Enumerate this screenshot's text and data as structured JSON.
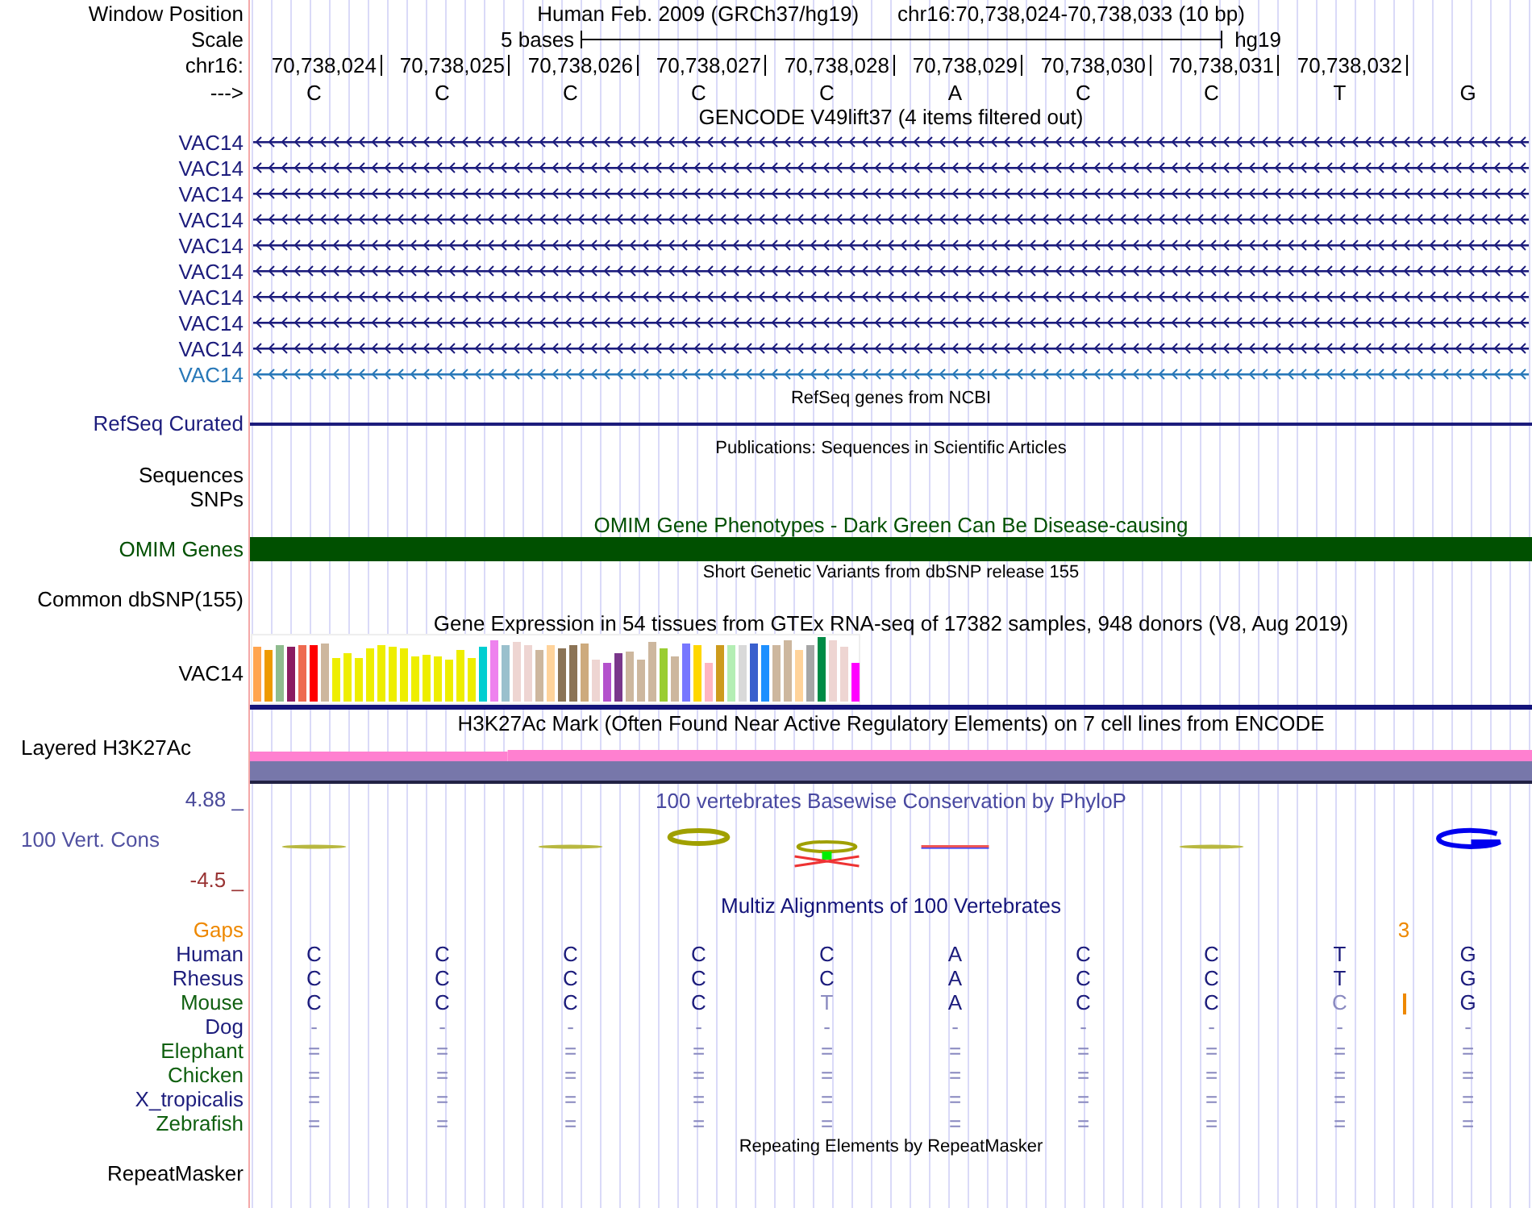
{
  "header": {
    "position_label": "Window Position",
    "assembly": "Human Feb. 2009 (GRCh37/hg19)",
    "range": "chr16:70,738,024-70,738,033 (10 bp)",
    "scale_label": "Scale",
    "scale_length": "5 bases",
    "scale_assembly": "hg19",
    "chrom_label": "chr16:",
    "ticks": [
      "70,738,024",
      "70,738,025",
      "70,738,026",
      "70,738,027",
      "70,738,028",
      "70,738,029",
      "70,738,030",
      "70,738,031",
      "70,738,032"
    ],
    "strand_label": "--->",
    "bases": [
      "C",
      "C",
      "C",
      "C",
      "C",
      "A",
      "C",
      "C",
      "T",
      "G"
    ]
  },
  "tracks": [
    {
      "kind": "genes",
      "title": "GENCODE V49lift37 (4 items filtered out)",
      "items": [
        {
          "name": "VAC14",
          "color": "#1c1c7c"
        },
        {
          "name": "VAC14",
          "color": "#1c1c7c"
        },
        {
          "name": "VAC14",
          "color": "#1c1c7c"
        },
        {
          "name": "VAC14",
          "color": "#1c1c7c"
        },
        {
          "name": "VAC14",
          "color": "#1c1c7c"
        },
        {
          "name": "VAC14",
          "color": "#1c1c7c"
        },
        {
          "name": "VAC14",
          "color": "#1c1c7c"
        },
        {
          "name": "VAC14",
          "color": "#1c1c7c"
        },
        {
          "name": "VAC14",
          "color": "#1c1c7c"
        },
        {
          "name": "VAC14",
          "color": "#2878b8"
        }
      ]
    },
    {
      "kind": "line",
      "title": "RefSeq genes from NCBI",
      "label": "RefSeq Curated",
      "color": "#1c1c7c"
    },
    {
      "kind": "empty",
      "title": "Publications: Sequences in Scientific Articles",
      "labels": [
        "Sequences",
        "SNPs"
      ]
    },
    {
      "kind": "bar",
      "title": "OMIM Gene Phenotypes - Dark Green Can Be Disease-causing",
      "label": "OMIM Genes",
      "color": "#005000"
    },
    {
      "kind": "empty",
      "title": "Short Genetic Variants from dbSNP release 155",
      "labels": [
        "Common dbSNP(155)"
      ]
    },
    {
      "kind": "gtex",
      "title": "Gene Expression in 54 tissues from GTEx RNA-seq of 17382 samples, 948 donors (V8, Aug 2019)",
      "label": "VAC14"
    },
    {
      "kind": "signal",
      "title": "H3K27Ac Mark (Often Found Near Active Regulatory Elements) on 7 cell lines from ENCODE",
      "label": "Layered H3K27Ac"
    },
    {
      "kind": "phylop",
      "title": "100 vertebrates Basewise Conservation by PhyloP",
      "label": "100 Vert. Cons",
      "max": "4.88 _",
      "min": "-4.5 _"
    },
    {
      "kind": "multiz",
      "title": "Multiz Alignments of 100 Vertebrates",
      "gaps": {
        "label": "Gaps",
        "count": "3"
      },
      "species": [
        {
          "name": "Human",
          "color": "#1c1c7c",
          "insertion": false,
          "bases": [
            "C",
            "C",
            "C",
            "C",
            "C",
            "A",
            "C",
            "C",
            "T",
            "G"
          ]
        },
        {
          "name": "Rhesus",
          "color": "#1c1c7c",
          "insertion": false,
          "bases": [
            "C",
            "C",
            "C",
            "C",
            "C",
            "A",
            "C",
            "C",
            "T",
            "G"
          ]
        },
        {
          "name": "Mouse",
          "color": "#106010",
          "insertion": true,
          "bases": [
            "C",
            "C",
            "C",
            "C",
            "T",
            "A",
            "C",
            "C",
            "C",
            "G"
          ]
        },
        {
          "name": "Dog",
          "color": "#1c1c7c",
          "insertion": false,
          "bases": [
            "-",
            "-",
            "-",
            "-",
            "-",
            "-",
            "-",
            "-",
            "-",
            "-"
          ]
        },
        {
          "name": "Elephant",
          "color": "#106010",
          "insertion": false,
          "bases": [
            "=",
            "=",
            "=",
            "=",
            "=",
            "=",
            "=",
            "=",
            "=",
            "="
          ]
        },
        {
          "name": "Chicken",
          "color": "#106010",
          "insertion": false,
          "bases": [
            "=",
            "=",
            "=",
            "=",
            "=",
            "=",
            "=",
            "=",
            "=",
            "="
          ]
        },
        {
          "name": "X_tropicalis",
          "color": "#1c1c7c",
          "insertion": false,
          "bases": [
            "=",
            "=",
            "=",
            "=",
            "=",
            "=",
            "=",
            "=",
            "=",
            "="
          ]
        },
        {
          "name": "Zebrafish",
          "color": "#106010",
          "insertion": false,
          "bases": [
            "=",
            "=",
            "=",
            "=",
            "=",
            "=",
            "=",
            "=",
            "=",
            "="
          ]
        }
      ]
    },
    {
      "kind": "empty",
      "title": "Repeating Elements by RepeatMasker",
      "labels": [
        "RepeatMasker"
      ]
    }
  ]
}
